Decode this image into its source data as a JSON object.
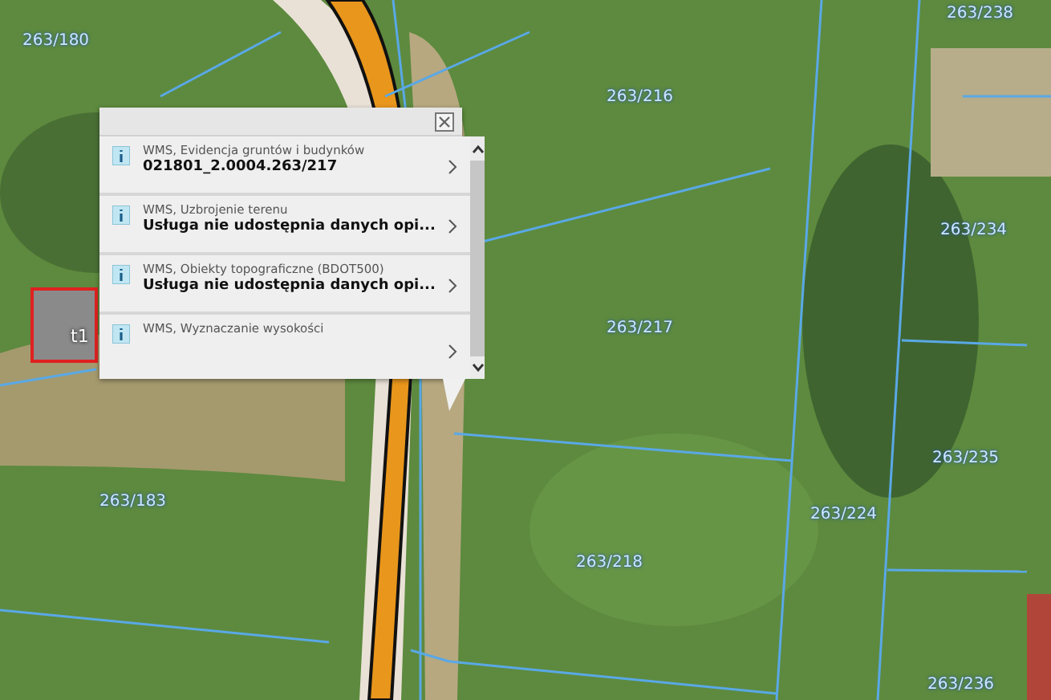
{
  "map": {
    "parcel_labels": [
      {
        "text": "263/180"
      },
      {
        "text": "263/238"
      },
      {
        "text": "263/216"
      },
      {
        "text": "263/234"
      },
      {
        "text": "263/217"
      },
      {
        "text": "263/235"
      },
      {
        "text": "263/224"
      },
      {
        "text": "263/218"
      },
      {
        "text": "263/183"
      },
      {
        "text": "263/236"
      }
    ],
    "building_label": "t1"
  },
  "popup": {
    "items": [
      {
        "layer": "WMS, Evidencja gruntów i budynków",
        "value": "021801_2.0004.263/217"
      },
      {
        "layer": "WMS, Uzbrojenie terenu",
        "value": "Usługa nie udostępnia danych opi..."
      },
      {
        "layer": "WMS, Obiekty topograficzne (BDOT500)",
        "value": "Usługa nie udostępnia danych opi..."
      },
      {
        "layer": "WMS, Wyznaczanie wysokości"
      }
    ]
  }
}
